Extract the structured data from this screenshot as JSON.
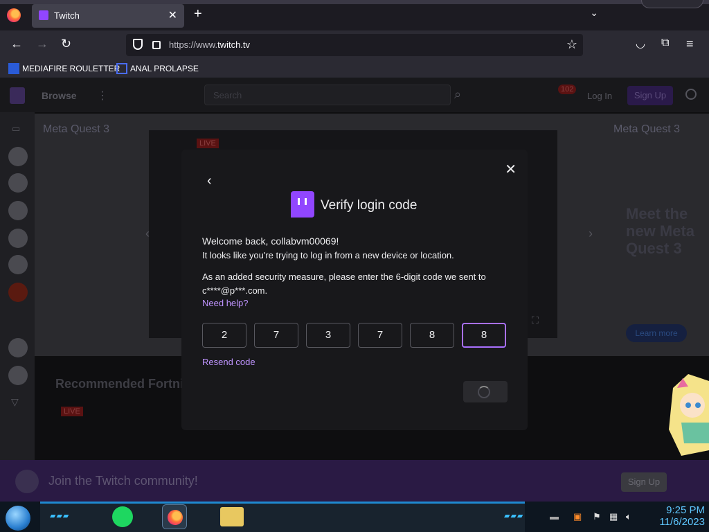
{
  "browser": {
    "tab_title": "Twitch",
    "tab_close": "✕",
    "new_tab": "+",
    "url_prefix": "https://www.",
    "url_domain": "twitch.tv",
    "bookmarks": [
      {
        "label": "MEDIAFIRE ROULETTER"
      },
      {
        "label": "ANAL PROLAPSE"
      }
    ]
  },
  "background_page": {
    "browse": "Browse",
    "search_placeholder": "Search",
    "notif_count": "102",
    "login": "Log In",
    "signup": "Sign Up",
    "meta_brand_left": "Meta Quest 3",
    "meta_brand_right": "Meta Quest 3",
    "hero_text": "Meet the new Meta Quest 3",
    "live_badge": "LIVE",
    "learn_more": "Learn more",
    "recommended": "Recommended Fortni",
    "join_text": "Join the Twitch community!",
    "join_signup": "Sign Up"
  },
  "modal": {
    "title": "Verify login code",
    "welcome": "Welcome back, collabvm00069!",
    "line1": "It looks like you're trying to log in from a new device or location.",
    "line2": "As an added security measure, please enter the 6-digit code we sent to c****@p***.com.",
    "need_help": "Need help?",
    "digits": [
      "2",
      "7",
      "3",
      "7",
      "8",
      "8"
    ],
    "resend": "Resend code"
  },
  "taskbar": {
    "time": "9:25 PM",
    "date": "11/6/2023"
  }
}
